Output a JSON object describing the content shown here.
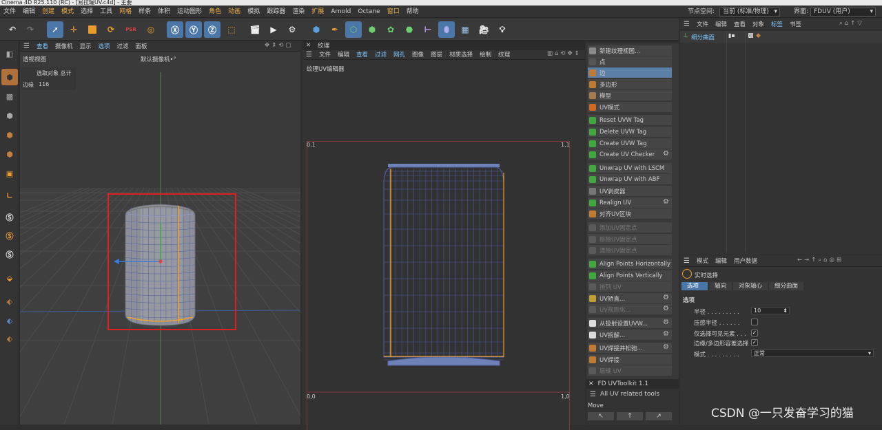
{
  "title": "Cinema 4D R25.110 (RC) - [易拉罐UV.c4d] - 主要",
  "menu": {
    "items": [
      {
        "label": "文件",
        "hl": false
      },
      {
        "label": "编辑",
        "hl": false
      },
      {
        "label": "创建",
        "hl": true
      },
      {
        "label": "模式",
        "hl": true
      },
      {
        "label": "选择",
        "hl": false
      },
      {
        "label": "工具",
        "hl": false
      },
      {
        "label": "网格",
        "hl": true
      },
      {
        "label": "样条",
        "hl": false
      },
      {
        "label": "体积",
        "hl": false
      },
      {
        "label": "运动图形",
        "hl": false
      },
      {
        "label": "角色",
        "hl": true
      },
      {
        "label": "动画",
        "hl": true
      },
      {
        "label": "模拟",
        "hl": false
      },
      {
        "label": "跟踪器",
        "hl": false
      },
      {
        "label": "渲染",
        "hl": false
      },
      {
        "label": "扩展",
        "hl": true
      },
      {
        "label": "Arnold",
        "hl": false
      },
      {
        "label": "Octane",
        "hl": false
      },
      {
        "label": "窗口",
        "hl": true
      },
      {
        "label": "帮助",
        "hl": false
      }
    ],
    "node_space_label": "节点空间:",
    "node_space_value": "当前 (标准/物理)",
    "interface_label": "界面:",
    "interface_value": "FDUV (用户)"
  },
  "viewport": {
    "menu": [
      "查看",
      "摄像机",
      "显示",
      "选项",
      "过滤",
      "面板"
    ],
    "menu_hl": [
      true,
      false,
      false,
      true,
      false,
      false
    ],
    "name": "透视视图",
    "camera": "默认摄像机",
    "camera_suffix": "•°",
    "stats_header": "选取对象  总计",
    "stats_label": "边缘",
    "stats_value": "116"
  },
  "uv_panel": {
    "tab": "纹理",
    "menu": [
      "文件",
      "编辑",
      "查看",
      "过滤",
      "网孔",
      "图像",
      "图层",
      "材质选择",
      "绘制",
      "纹理"
    ],
    "menu_hl": [
      false,
      false,
      true,
      true,
      true,
      false,
      false,
      false,
      false,
      false
    ],
    "subtitle": "纹理UV编辑器",
    "corner_tl": "0,1",
    "corner_tr": "1,1",
    "corner_bl": "0,0",
    "corner_br": "1,0"
  },
  "commands": [
    {
      "label": "新建纹理视图...",
      "color": "#8a8a8a",
      "state": "normal"
    },
    {
      "label": "点",
      "color": "#555555",
      "state": "normal"
    },
    {
      "label": "边",
      "color": "#c07a32",
      "state": "selected"
    },
    {
      "label": "多边形",
      "color": "#c07a32",
      "state": "normal"
    },
    {
      "label": "模型",
      "color": "#a87a50",
      "state": "normal"
    },
    {
      "label": "UV模式",
      "color": "#d06a20",
      "state": "normal"
    },
    {
      "label": "Reset UVW Tag",
      "color": "#3fa83f",
      "state": "normal"
    },
    {
      "label": "Delete UVW Tag",
      "color": "#3fa83f",
      "state": "normal"
    },
    {
      "label": "Create UVW Tag",
      "color": "#3fa83f",
      "state": "normal"
    },
    {
      "label": "Create UV Checker",
      "color": "#3fa83f",
      "state": "normal",
      "gear": true
    },
    {
      "label": "Unwrap UV with LSCM",
      "color": "#3fa83f",
      "state": "normal"
    },
    {
      "label": "Unwrap UV with ABF",
      "color": "#3fa83f",
      "state": "normal"
    },
    {
      "label": "UV剥皮器",
      "color": "#777777",
      "state": "normal"
    },
    {
      "label": "Realign UV",
      "color": "#3fa83f",
      "state": "normal",
      "gear": true
    },
    {
      "label": "对齐UV区块",
      "color": "#c07a32",
      "state": "normal"
    },
    {
      "label": "添加UV固定点",
      "color": "#5a5a5a",
      "state": "disabled"
    },
    {
      "label": "移除UV固定点",
      "color": "#5a5a5a",
      "state": "disabled"
    },
    {
      "label": "清除UV固定点",
      "color": "#5a5a5a",
      "state": "disabled"
    },
    {
      "label": "Align Points Horizontally",
      "color": "#3fa83f",
      "state": "normal"
    },
    {
      "label": "Align Points Vertically",
      "color": "#3fa83f",
      "state": "normal"
    },
    {
      "label": "排列 UV",
      "color": "#5a5a5a",
      "state": "disabled"
    },
    {
      "label": "UV矫直...",
      "color": "#c0a030",
      "state": "normal",
      "gear": true
    },
    {
      "label": "UV规则化...",
      "color": "#5a5a5a",
      "state": "disabled",
      "gear": true
    },
    {
      "label": "从投射设置UVW...",
      "color": "#dddddd",
      "state": "normal",
      "gear": true
    },
    {
      "label": "UV拆解...",
      "color": "#dddddd",
      "state": "normal",
      "gear": true
    },
    {
      "label": "UV焊接并松弛...",
      "color": "#c07a32",
      "state": "normal",
      "gear": true
    },
    {
      "label": "UV焊接",
      "color": "#c07a32",
      "state": "normal"
    },
    {
      "label": "层缝 UV",
      "color": "#5a5a5a",
      "state": "disabled"
    }
  ],
  "toolkit": {
    "title": "FD UVToolkit 1.1",
    "subtitle": "All UV related tools",
    "move_label": "Move"
  },
  "object_manager": {
    "menu": [
      "文件",
      "编辑",
      "查看",
      "对象",
      "标签",
      "书签"
    ],
    "menu_hl": [
      false,
      false,
      false,
      false,
      true,
      false
    ],
    "object_name": "细分曲面"
  },
  "attributes": {
    "menu": [
      "模式",
      "编辑",
      "用户数据"
    ],
    "tool_name": "实时选择",
    "tabs": [
      "选项",
      "轴向",
      "对象轴心",
      "细分曲面"
    ],
    "section": "选项",
    "fields": {
      "radius_label": "半径",
      "radius_value": "10",
      "pressure_label": "压感半径",
      "visible_label": "仅选择可见元素",
      "tolerance_label": "边缘/多边形容差选择",
      "mode_label": "模式",
      "mode_value": "正常"
    }
  },
  "watermark": "CSDN @一只发奋学习的猫"
}
